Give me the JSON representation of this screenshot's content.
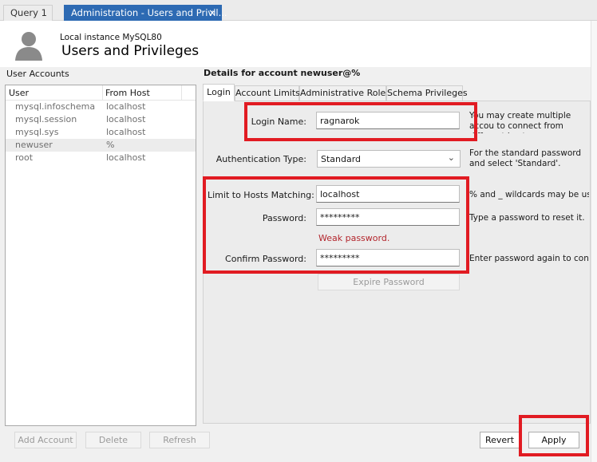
{
  "tabs": [
    {
      "label": "Query 1"
    },
    {
      "label": "Administration - Users and Privil...",
      "close": "×"
    }
  ],
  "header": {
    "instance": "Local instance MySQL80",
    "title": "Users and Privileges"
  },
  "user_accounts": {
    "section_label": "User Accounts",
    "columns": [
      "User",
      "From Host"
    ],
    "rows": [
      {
        "user": "mysql.infoschema",
        "host": "localhost"
      },
      {
        "user": "mysql.session",
        "host": "localhost"
      },
      {
        "user": "mysql.sys",
        "host": "localhost"
      },
      {
        "user": "newuser",
        "host": "%"
      },
      {
        "user": "root",
        "host": "localhost"
      }
    ],
    "selected_index": 3
  },
  "details": {
    "title": "Details for account newuser@%",
    "subtabs": [
      "Login",
      "Account Limits",
      "Administrative Roles",
      "Schema Privileges"
    ],
    "active_subtab": "Login"
  },
  "form": {
    "login_name": {
      "label": "Login Name:",
      "value": "ragnarok",
      "hint": "You may create multiple accou to connect from different hosts"
    },
    "auth_type": {
      "label": "Authentication Type:",
      "value": "Standard",
      "hint": "For the standard password and select 'Standard'."
    },
    "hosts": {
      "label": "Limit to Hosts Matching:",
      "value": "localhost",
      "hint": "% and _ wildcards may be used"
    },
    "password": {
      "label": "Password:",
      "value": "*********",
      "hint": "Type a password to reset it."
    },
    "weak_msg": "Weak password.",
    "confirm": {
      "label": "Confirm Password:",
      "value": "*********",
      "hint": "Enter password again to confirm"
    },
    "expire_label": "Expire Password"
  },
  "buttons": {
    "add_account": "Add Account",
    "delete": "Delete",
    "refresh": "Refresh",
    "revert": "Revert",
    "apply": "Apply"
  },
  "colors": {
    "active_tab": "#2d6ab3",
    "highlight": "#e11b22",
    "weak": "#b3262d"
  }
}
